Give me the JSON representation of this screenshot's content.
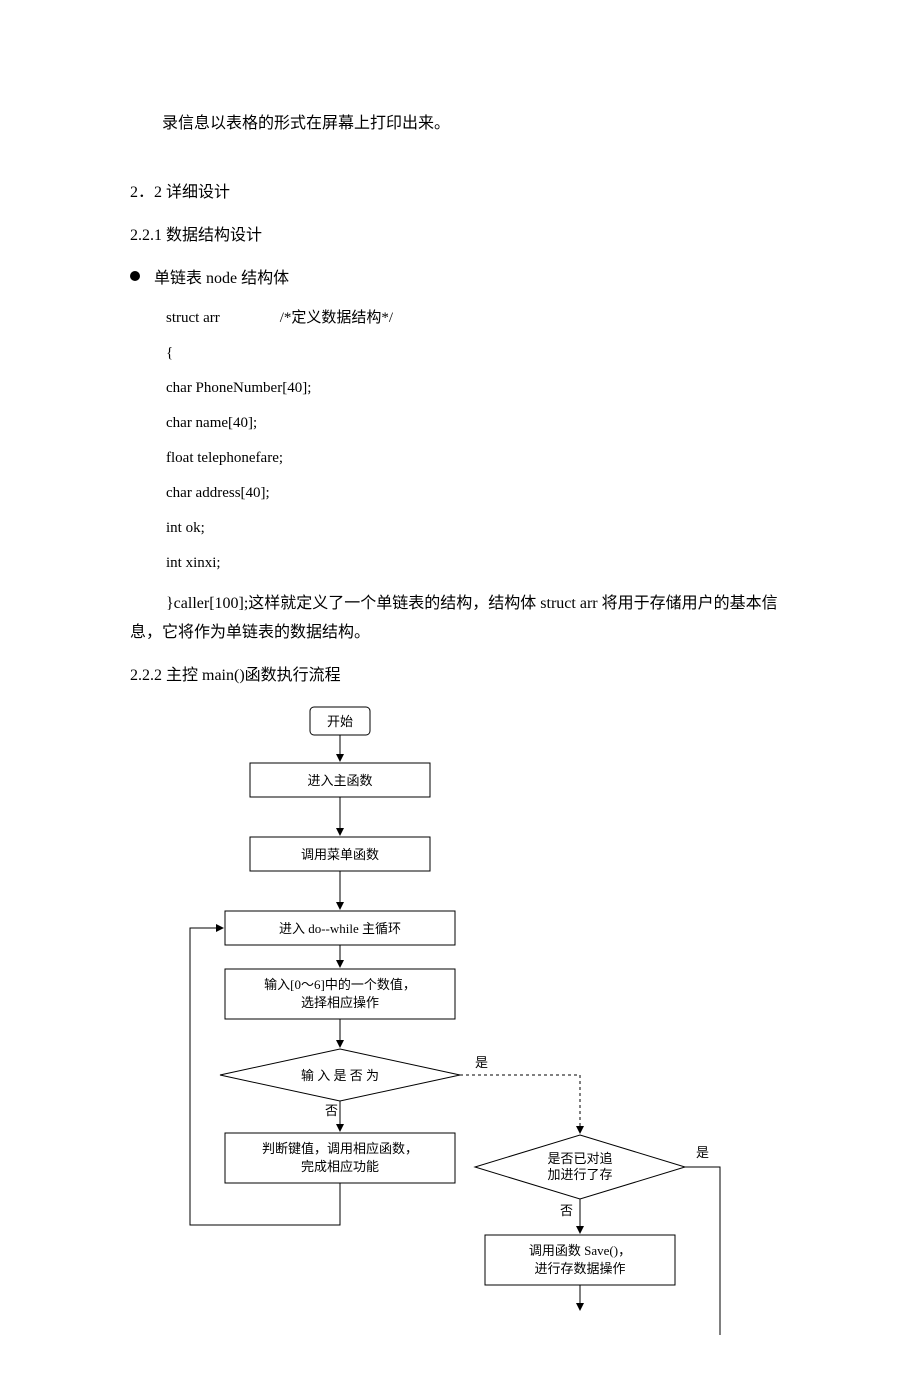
{
  "para1": "录信息以表格的形式在屏幕上打印出来。",
  "sec1": "2．2 详细设计",
  "sec2": "2.2.1 数据结构设计",
  "bullet1": "单链表 node 结构体",
  "code": {
    "l1": "struct arr",
    "l1c": "/*定义数据结构*/",
    "l2": "{",
    "l3": "char PhoneNumber[40];",
    "l4": "char name[40];",
    "l5": "float telephonefare;",
    "l6": "char address[40];",
    "l7": "int ok;",
    "l8": "int xinxi;"
  },
  "para2": "}caller[100];这样就定义了一个单链表的结构，结构体 struct arr 将用于存储用户的基本信息，它将作为单链表的数据结构。",
  "sec3": "2.2.2 主控 main()函数执行流程",
  "flow": {
    "start": "开始",
    "b1": "进入主函数",
    "b2": "调用菜单函数",
    "b3": "进入 do--while 主循环",
    "b4l1": "输入[0～6]中的一个数值，",
    "b4l2": "选择相应操作",
    "d1": "输 入 是 否 为",
    "b5l1": "判断键值，调用相应函数，",
    "b5l2": "完成相应功能",
    "d2l1": "是否已对追",
    "d2l2": "加进行了存",
    "b6l1": "调用函数 Save()，",
    "b6l2": "进行存数据操作",
    "yes": "是",
    "no": "否"
  }
}
